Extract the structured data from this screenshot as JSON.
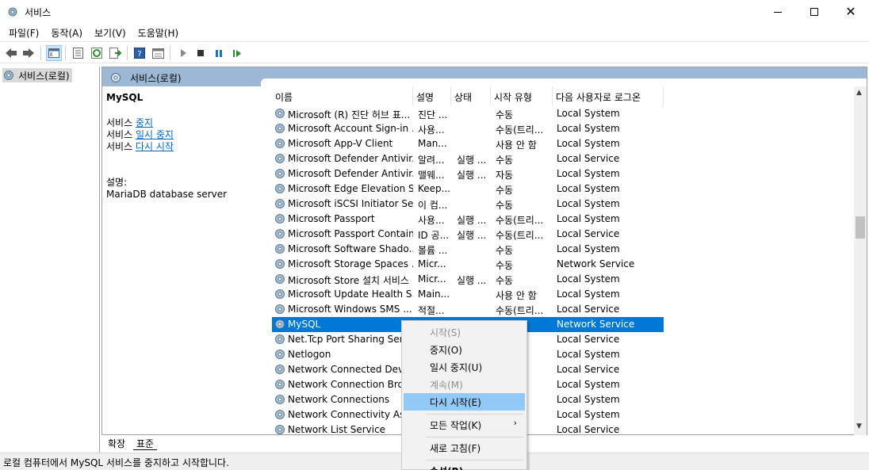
{
  "window": {
    "title": "서비스"
  },
  "menu": [
    "파일(F)",
    "동작(A)",
    "보기(V)",
    "도움말(H)"
  ],
  "toolbar": {
    "icons": [
      "back-arrow-icon",
      "forward-arrow-icon",
      "show-tree-icon",
      "properties-icon",
      "refresh-icon",
      "export-icon",
      "help-icon",
      "view-icon",
      "start-service-icon",
      "stop-service-icon",
      "pause-service-icon",
      "restart-service-icon"
    ]
  },
  "tree": {
    "root_label": "서비스(로컬)"
  },
  "panel": {
    "header_title": "서비스(로컬)"
  },
  "description": {
    "service_name": "MySQL",
    "service_prefix": "서비스",
    "link_stop": "중지",
    "link_pause": "일시 중지",
    "link_restart": "다시 시작",
    "desc_label": "설명:",
    "desc_text": "MariaDB database server"
  },
  "columns": [
    "이름",
    "설명",
    "상태",
    "시작 유형",
    "다음 사용자로 로그온"
  ],
  "rows": [
    {
      "name": "Microsoft (R) 진단 허브 표...",
      "desc": "진단 ...",
      "status": "",
      "start": "수동",
      "logon": "Local System"
    },
    {
      "name": "Microsoft Account Sign-in ...",
      "desc": "사용...",
      "status": "",
      "start": "수동(트리...",
      "logon": "Local System"
    },
    {
      "name": "Microsoft App-V Client",
      "desc": "Man...",
      "status": "",
      "start": "사용 안 함",
      "logon": "Local System"
    },
    {
      "name": "Microsoft Defender Antivir...",
      "desc": "알려...",
      "status": "실행 ...",
      "start": "수동",
      "logon": "Local Service"
    },
    {
      "name": "Microsoft Defender Antivir...",
      "desc": "맬웨...",
      "status": "실행 ...",
      "start": "자동",
      "logon": "Local System"
    },
    {
      "name": "Microsoft Edge Elevation S...",
      "desc": "Keep...",
      "status": "",
      "start": "수동",
      "logon": "Local System"
    },
    {
      "name": "Microsoft iSCSI Initiator Se...",
      "desc": "이 컴...",
      "status": "",
      "start": "수동",
      "logon": "Local System"
    },
    {
      "name": "Microsoft Passport",
      "desc": "사용...",
      "status": "실행 ...",
      "start": "수동(트리...",
      "logon": "Local System"
    },
    {
      "name": "Microsoft Passport Container",
      "desc": "ID 공...",
      "status": "실행 ...",
      "start": "수동(트리...",
      "logon": "Local Service"
    },
    {
      "name": "Microsoft Software Shado...",
      "desc": "볼륨 ...",
      "status": "",
      "start": "수동",
      "logon": "Local System"
    },
    {
      "name": "Microsoft Storage Spaces ...",
      "desc": "Micr...",
      "status": "",
      "start": "수동",
      "logon": "Network Service"
    },
    {
      "name": "Microsoft Store 설치 서비스",
      "desc": "Micr...",
      "status": "실행 ...",
      "start": "수동",
      "logon": "Local System"
    },
    {
      "name": "Microsoft Update Health S...",
      "desc": "Main...",
      "status": "",
      "start": "사용 안 함",
      "logon": "Local System"
    },
    {
      "name": "Microsoft Windows SMS ...",
      "desc": "적절...",
      "status": "",
      "start": "수동(트리...",
      "logon": "Local Service"
    },
    {
      "name": "MySQL",
      "desc": "",
      "status": "",
      "start": "",
      "logon": "Network Service",
      "selected": true
    },
    {
      "name": "Net.Tcp Port Sharing Servi",
      "desc": "",
      "status": "",
      "start": "함",
      "logon": "Local Service"
    },
    {
      "name": "Netlogon",
      "desc": "",
      "status": "",
      "start": "",
      "logon": "Local System"
    },
    {
      "name": "Network Connected Device",
      "desc": "",
      "status": "",
      "start": "리...",
      "logon": "Local Service"
    },
    {
      "name": "Network Connection Broke",
      "desc": "",
      "status": "",
      "start": "리...",
      "logon": "Local System"
    },
    {
      "name": "Network Connections",
      "desc": "",
      "status": "",
      "start": "",
      "logon": "Local System"
    },
    {
      "name": "Network Connectivity Assis",
      "desc": "",
      "status": "",
      "start": "리...",
      "logon": "Local System"
    },
    {
      "name": "Network List Service",
      "desc": "",
      "status": "",
      "start": "리...",
      "logon": "Local Service"
    }
  ],
  "tabs": [
    "확장",
    "표준"
  ],
  "context_menu": {
    "start": "시작(S)",
    "stop": "중지(O)",
    "pause": "일시 중지(U)",
    "resume": "계속(M)",
    "restart": "다시 시작(E)",
    "all_tasks": "모든 작업(K)",
    "refresh": "새로 고침(F)",
    "properties": "속성(R)"
  },
  "status": {
    "text": "로컬 컴퓨터에서 MySQL 서비스를 중지하고 시작합니다."
  },
  "colors": {
    "selection": "#0078d7",
    "menu_highlight": "#91c9f7",
    "header_band": "#9db8d4",
    "link": "#0066cc"
  }
}
